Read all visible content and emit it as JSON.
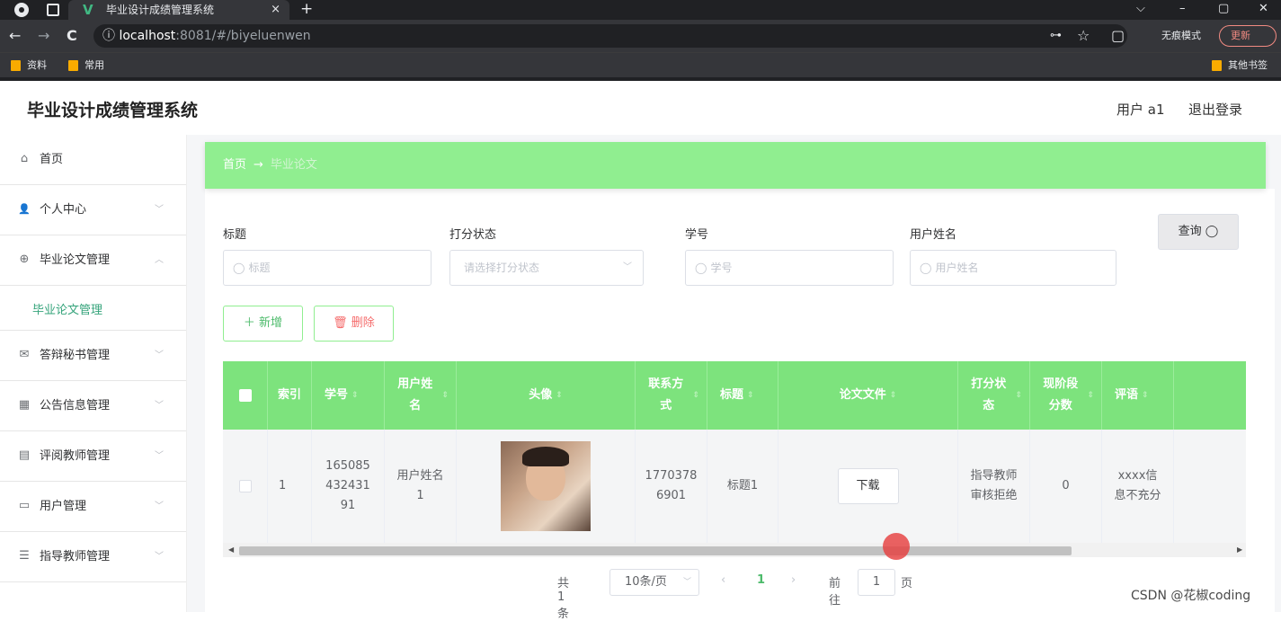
{
  "browser": {
    "tab_title": "毕业设计成绩管理系统",
    "tab_close": "×",
    "new_tab": "+",
    "url_host": "localhost",
    "url_path": ":8081/#/biyeluenwen",
    "incognito_label": "无痕模式",
    "update_label": "更新",
    "bookmarks": [
      "资料",
      "常用"
    ],
    "other_bookmarks": "其他书签",
    "icons": {
      "back": "←",
      "forward": "→",
      "reload": "C",
      "info": "ⓘ",
      "key": "⊶",
      "star": "☆",
      "minimize": "–",
      "restore": "▢",
      "close": "✕",
      "dropdown": "⌵"
    }
  },
  "header": {
    "title": "毕业设计成绩管理系统",
    "user_label": "用户 a1",
    "logout_label": "退出登录"
  },
  "sidebar": {
    "items": [
      {
        "label": "首页",
        "icon": "⌂"
      },
      {
        "label": "个人中心",
        "icon": "👤"
      },
      {
        "label": "毕业论文管理",
        "icon": "⊕"
      },
      {
        "label": "答辩秘书管理",
        "icon": "✉"
      },
      {
        "label": "公告信息管理",
        "icon": "▦"
      },
      {
        "label": "评阅教师管理",
        "icon": "▤"
      },
      {
        "label": "用户管理",
        "icon": "▭"
      },
      {
        "label": "指导教师管理",
        "icon": "☰"
      }
    ],
    "sub_item": "毕业论文管理",
    "arrow_down": "﹀",
    "arrow_up": "︿"
  },
  "breadcrumb": {
    "home": "首页",
    "separator": "→",
    "current": "毕业论文"
  },
  "search": {
    "fields": [
      {
        "label": "标题",
        "placeholder": "标题"
      },
      {
        "label": "打分状态",
        "placeholder": "请选择打分状态"
      },
      {
        "label": "学号",
        "placeholder": "学号"
      },
      {
        "label": "用户姓名",
        "placeholder": "用户姓名"
      }
    ],
    "search_icon": "◯",
    "select_arrow": "﹀",
    "query_label": "查询 ◯"
  },
  "actions": {
    "add_label": "＋ 新增",
    "delete_label": "🗑 删除"
  },
  "table": {
    "columns": [
      "索引",
      "学号",
      "用户姓名",
      "头像",
      "联系方式",
      "标题",
      "论文文件",
      "打分状态",
      "现阶段分数",
      "评语"
    ],
    "sort_icon": "⇕",
    "rows": [
      {
        "index": "1",
        "student_no": "16508543243191",
        "username": "用户姓名1",
        "contact": "17703786901",
        "title": "标题1",
        "file_button": "下载",
        "score_status": "指导教师审核拒绝",
        "score": "0",
        "comment": "xxxx信息不充分"
      }
    ]
  },
  "pagination": {
    "total": "共 1 条",
    "page_size": "10条/页",
    "prev": "‹",
    "current_page": "1",
    "next": "›",
    "goto_label": "前往",
    "goto_value": "1",
    "page_suffix": "页"
  },
  "watermark": "CSDN @花椒coding"
}
